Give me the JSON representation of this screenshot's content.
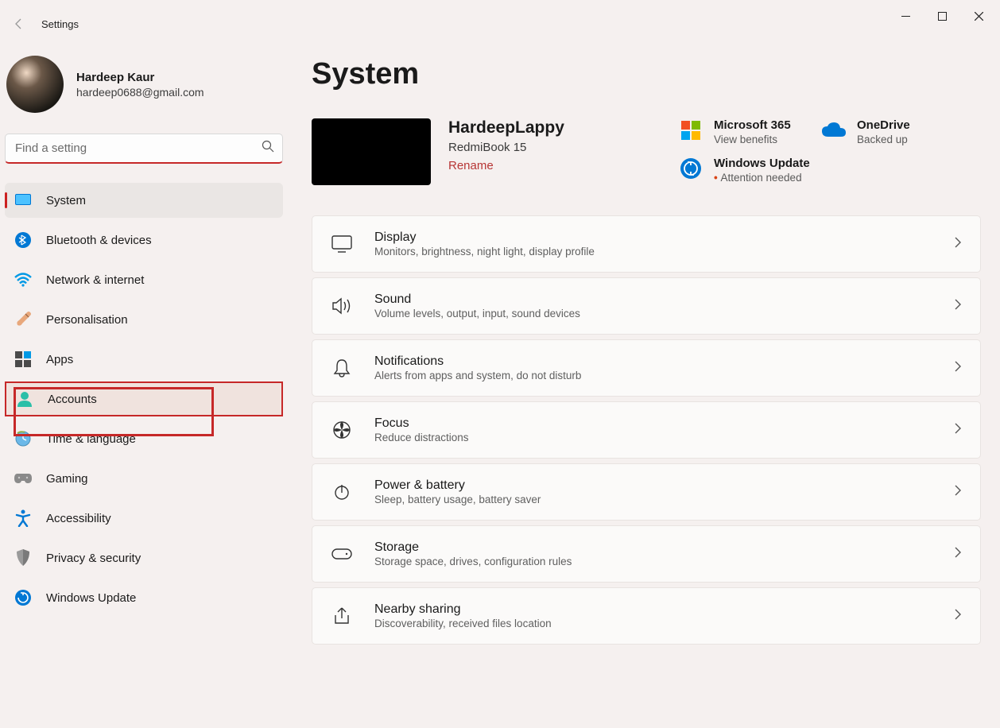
{
  "window": {
    "title": "Settings"
  },
  "profile": {
    "name": "Hardeep Kaur",
    "email": "hardeep0688@gmail.com"
  },
  "search": {
    "placeholder": "Find a setting"
  },
  "nav": [
    {
      "id": "system",
      "label": "System"
    },
    {
      "id": "bluetooth",
      "label": "Bluetooth & devices"
    },
    {
      "id": "network",
      "label": "Network & internet"
    },
    {
      "id": "personalisation",
      "label": "Personalisation"
    },
    {
      "id": "apps",
      "label": "Apps"
    },
    {
      "id": "accounts",
      "label": "Accounts"
    },
    {
      "id": "time",
      "label": "Time & language"
    },
    {
      "id": "gaming",
      "label": "Gaming"
    },
    {
      "id": "accessibility",
      "label": "Accessibility"
    },
    {
      "id": "privacy",
      "label": "Privacy & security"
    },
    {
      "id": "update",
      "label": "Windows Update"
    }
  ],
  "page": {
    "title": "System",
    "device": {
      "name": "HardeepLappy",
      "model": "RedmiBook 15",
      "rename": "Rename"
    },
    "status": [
      {
        "id": "ms365",
        "title": "Microsoft 365",
        "sub": "View benefits",
        "alert": false
      },
      {
        "id": "onedrive",
        "title": "OneDrive",
        "sub": "Backed up",
        "alert": false
      },
      {
        "id": "winupdate",
        "title": "Windows Update",
        "sub": "Attention needed",
        "alert": true
      }
    ],
    "settings": [
      {
        "id": "display",
        "title": "Display",
        "desc": "Monitors, brightness, night light, display profile"
      },
      {
        "id": "sound",
        "title": "Sound",
        "desc": "Volume levels, output, input, sound devices"
      },
      {
        "id": "notifications",
        "title": "Notifications",
        "desc": "Alerts from apps and system, do not disturb"
      },
      {
        "id": "focus",
        "title": "Focus",
        "desc": "Reduce distractions"
      },
      {
        "id": "power",
        "title": "Power & battery",
        "desc": "Sleep, battery usage, battery saver"
      },
      {
        "id": "storage",
        "title": "Storage",
        "desc": "Storage space, drives, configuration rules"
      },
      {
        "id": "nearby",
        "title": "Nearby sharing",
        "desc": "Discoverability, received files location"
      }
    ]
  }
}
